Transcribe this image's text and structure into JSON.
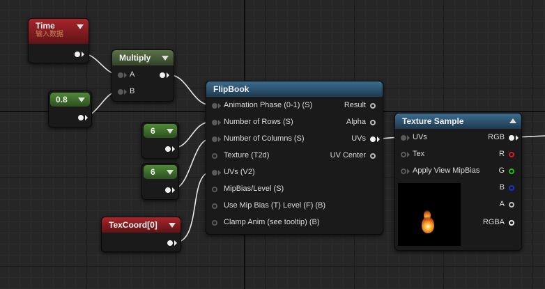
{
  "time_node": {
    "title": "Time",
    "subtitle": "输入数据"
  },
  "multiply_node": {
    "title": "Multiply",
    "input_a": "A",
    "input_b": "B"
  },
  "const_08": {
    "value": "0.8"
  },
  "const_rows": {
    "value": "6"
  },
  "const_cols": {
    "value": "6"
  },
  "texcoord_node": {
    "title": "TexCoord[0]"
  },
  "flipbook_node": {
    "title": "FlipBook",
    "inputs": [
      "Animation  Phase (0-1) (S)",
      "Number of Rows (S)",
      "Number of Columns (S)",
      "Texture (T2d)",
      "UVs (V2)",
      "MipBias/Level (S)",
      "Use Mip Bias (T) Level (F) (B)",
      "Clamp Anim (see tooltip) (B)"
    ],
    "outputs": [
      "Result",
      "Alpha",
      "UVs",
      "UV Center"
    ]
  },
  "texture_sample_node": {
    "title": "Texture Sample",
    "inputs": [
      "UVs",
      "Tex",
      "Apply View MipBias"
    ],
    "outputs": [
      "RGB",
      "R",
      "G",
      "B",
      "A",
      "RGBA"
    ],
    "channel_colors": {
      "R": "#d02020",
      "G": "#20c020",
      "B": "#2030d0",
      "A": "#bdbdbd"
    }
  },
  "colors": {
    "background": "#262626",
    "wire": "#e8e8e8",
    "time_header": "#a8252a",
    "multiply_header": "#5b7346",
    "constant_header": "#4f8a36",
    "flipbook_header": "#3c6d8f",
    "texture_sample_header": "#3c6d8f"
  }
}
